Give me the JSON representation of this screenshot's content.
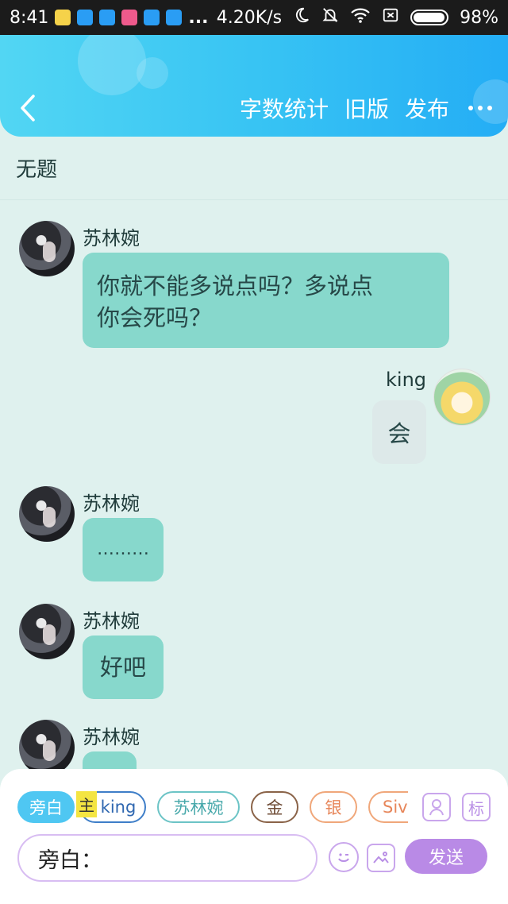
{
  "status_bar": {
    "time": "8:41",
    "more": "...",
    "network_speed": "4.20K/s",
    "battery": "98%"
  },
  "header": {
    "nav": [
      "字数统计",
      "旧版",
      "发布"
    ]
  },
  "article": {
    "title": "无题"
  },
  "messages": [
    {
      "sender": "苏林婉",
      "text_lines": [
        "你就不能多说点吗？多说点",
        "你会死吗？"
      ]
    },
    {
      "sender": "king",
      "text": "会"
    },
    {
      "sender": "苏林婉",
      "text": "………"
    },
    {
      "sender": "苏林婉",
      "text": "好吧"
    },
    {
      "sender": "苏林婉",
      "text": ""
    }
  ],
  "roles": {
    "narrator": "旁白",
    "main_badge": "主",
    "king": "king",
    "su": "苏林婉",
    "gold": "金",
    "silver": "银",
    "siv": "Siv",
    "tag": "标"
  },
  "composer": {
    "input_value": "旁白：",
    "send_label": "发送"
  },
  "colors": {
    "header_gradient_start": "#52d6f3",
    "header_gradient_end": "#24adf5",
    "bubble_in": "#87d8cc",
    "bubble_out": "#dde9e9",
    "send_button": "#b98ae6",
    "background": "#dff1ee"
  }
}
